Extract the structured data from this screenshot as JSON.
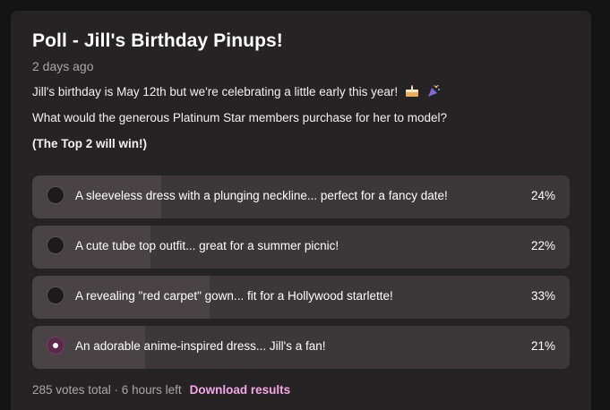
{
  "poll": {
    "title": "Poll - Jill's Birthday Pinups!",
    "timestamp": "2 days ago",
    "description": {
      "line1": "Jill's birthday is May 12th but we're celebrating a little early this year!",
      "line2": "What would the generous Platinum Star members purchase for her to model?",
      "line3": "(The Top 2 will win!)"
    },
    "emojis": [
      "cake-icon",
      "party-popper-icon"
    ],
    "options": [
      {
        "label": "A sleeveless dress with a plunging neckline... perfect for a fancy date!",
        "percent_label": "24%",
        "percent": 24,
        "selected": false
      },
      {
        "label": "A cute tube top outfit... great for a summer picnic!",
        "percent_label": "22%",
        "percent": 22,
        "selected": false
      },
      {
        "label": "A revealing \"red carpet\" gown... fit for a Hollywood starlette!",
        "percent_label": "33%",
        "percent": 33,
        "selected": false
      },
      {
        "label": "An adorable anime-inspired dress... Jill's a fan!",
        "percent_label": "21%",
        "percent": 21,
        "selected": true
      }
    ],
    "footer": {
      "summary": "285 votes total · 6 hours left",
      "download_label": "Download results"
    },
    "colors": {
      "accent": "#f5a6e6",
      "selected_radio": "#5a2a4a",
      "card_background": "#262324",
      "option_background": "#3c3739",
      "option_fill": "#494345"
    }
  }
}
